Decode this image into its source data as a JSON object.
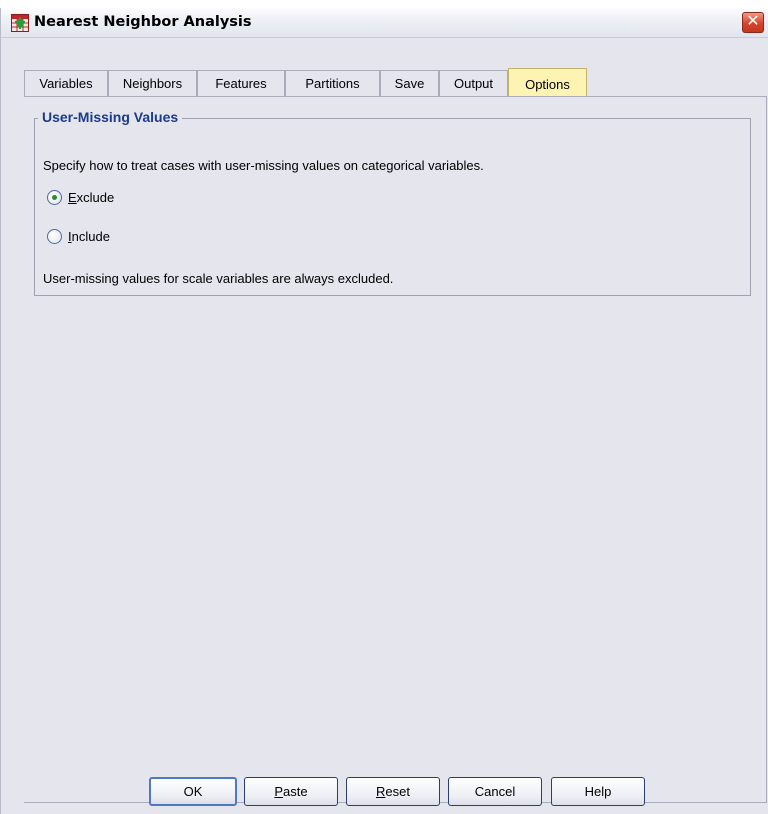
{
  "window": {
    "title": "Nearest Neighbor Analysis",
    "close_symbol": "✕"
  },
  "tabs": [
    {
      "label": "Variables",
      "active": false
    },
    {
      "label": "Neighbors",
      "active": false
    },
    {
      "label": "Features",
      "active": false
    },
    {
      "label": "Partitions",
      "active": false
    },
    {
      "label": "Save",
      "active": false
    },
    {
      "label": "Output",
      "active": false
    },
    {
      "label": "Options",
      "active": true
    }
  ],
  "user_missing": {
    "group_title": "User-Missing Values",
    "description": "Specify how to treat cases with user-missing values on categorical variables.",
    "options": [
      {
        "label_first": "E",
        "label_rest": "xclude",
        "selected": true
      },
      {
        "label_first": "I",
        "label_rest": "nclude",
        "selected": false
      }
    ],
    "note": "User-missing values for scale variables are always excluded."
  },
  "buttons": {
    "ok": "OK",
    "paste_first": "P",
    "paste_rest": "aste",
    "reset_first": "R",
    "reset_rest": "eset",
    "cancel": "Cancel",
    "help": "Help"
  },
  "colors": {
    "dialog_bg": "#e4e5ed",
    "active_tab": "#fdf3b2",
    "group_title": "#1b3a8c",
    "close_button": "#d6432a"
  },
  "icons": [
    "app-table-icon",
    "close-icon",
    "radio-selected-icon",
    "radio-unselected-icon"
  ]
}
